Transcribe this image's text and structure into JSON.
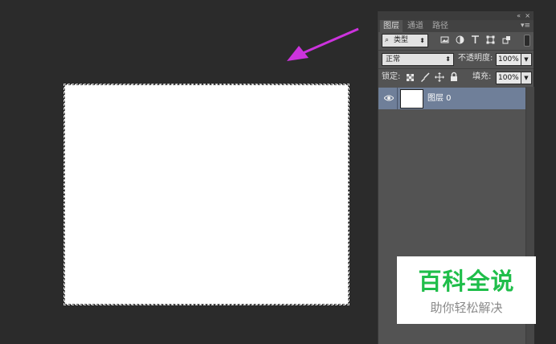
{
  "panel": {
    "collapse_glyph": "«",
    "close_glyph": "×",
    "tabs": [
      {
        "label": "图层",
        "active": true
      },
      {
        "label": "通道",
        "active": false
      },
      {
        "label": "路径",
        "active": false
      }
    ],
    "menu_glyph": "▾≡"
  },
  "filter": {
    "search_glyph": "⌕",
    "kind_label": "类型",
    "dropdown_glyph": "⬍",
    "icons": [
      "image-filter-icon",
      "adjustment-filter-icon",
      "type-filter-icon",
      "shape-filter-icon",
      "smart-object-filter-icon"
    ]
  },
  "blend": {
    "mode": "正常",
    "opacity_label": "不透明度:",
    "opacity_value": "100%"
  },
  "lock": {
    "label": "锁定:",
    "fill_label": "填充:",
    "fill_value": "100%"
  },
  "layers": [
    {
      "name": "图层 0",
      "visible": true,
      "selected": true
    }
  ],
  "watermark": {
    "title": "百科全说",
    "subtitle": "助你轻松解决"
  },
  "colors": {
    "background": "#2b2b2b",
    "panel": "#535353",
    "selected_layer": "#6f7f99",
    "arrow": "#cc33dd",
    "watermark_green": "#1fbe4a"
  }
}
